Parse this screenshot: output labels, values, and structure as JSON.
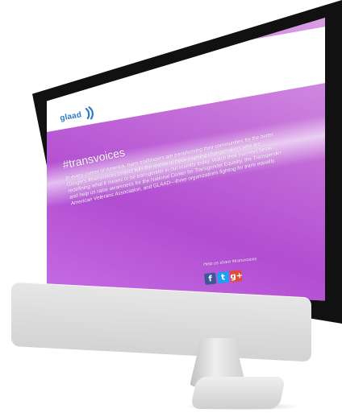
{
  "brand": {
    "logo_text": "glaad"
  },
  "content": {
    "title": "#transvoices",
    "body": "In every corner of America, trans trailblazers are transforming their communities for the better. Google's #transvoices project tells the stories of three inspiring changemakers who are redefining what it means to be transgender in our country today. Watch their journeys below and help us raise awareness for the National Center for Transgender Equality, the Transgender American Veterans Association, and GLAAD—three organizations fighting for trans equality."
  },
  "share": {
    "label": "Help us share #transvoices",
    "buttons": [
      {
        "label": "f",
        "icon": "facebook-icon",
        "color": "#3b5998"
      },
      {
        "label": "t",
        "icon": "twitter-icon",
        "color": "#1da1f2"
      },
      {
        "label": "g+",
        "icon": "google-plus-icon",
        "color": "#dd4b39"
      }
    ]
  }
}
